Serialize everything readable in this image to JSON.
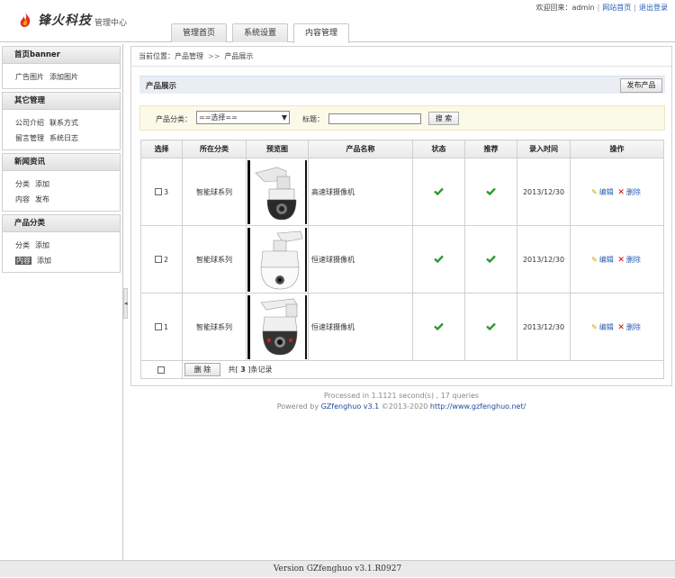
{
  "header": {
    "brand": "锋火科技",
    "brand_sub": "管理中心",
    "welcome": "欢迎回来：admin",
    "site_home": "网站首页",
    "logout": "退出登录"
  },
  "tabs": [
    {
      "label": "管理首页"
    },
    {
      "label": "系统设置"
    },
    {
      "label": "内容管理"
    }
  ],
  "sidebar": [
    {
      "title": "首页banner",
      "rows": [
        [
          "广告图片",
          "添加图片"
        ]
      ]
    },
    {
      "title": "其它管理",
      "rows": [
        [
          "公司介绍",
          "联系方式"
        ],
        [
          "留言管理",
          "系统日志"
        ]
      ]
    },
    {
      "title": "新闻资讯",
      "rows": [
        [
          "分类",
          "添加"
        ],
        [
          "内容",
          "发布"
        ]
      ]
    },
    {
      "title": "产品分类",
      "rows": [
        [
          "分类",
          "添加"
        ],
        [
          "内容",
          "添加"
        ]
      ]
    }
  ],
  "breadcrumb": {
    "prefix": "当前位置：",
    "level1": "产品管理",
    "sep": ">>",
    "level2": "产品展示"
  },
  "panel": {
    "title": "产品展示",
    "publish": "发布产品"
  },
  "search": {
    "category_label": "产品分类：",
    "category_value": "==选择==",
    "title_label": "标题：",
    "title_value": "",
    "button": "搜 索"
  },
  "table": {
    "headers": [
      "选择",
      "所在分类",
      "预览图",
      "产品名称",
      "状态",
      "推荐",
      "录入时间",
      "操作"
    ],
    "rows": [
      {
        "id": "3",
        "category": "智能球系列",
        "name": "高速球摄像机",
        "date": "2013/12/30",
        "thumb": "camera-dome-dark"
      },
      {
        "id": "2",
        "category": "智能球系列",
        "name": "恒速球摄像机",
        "date": "2013/12/30",
        "thumb": "camera-dome-white"
      },
      {
        "id": "1",
        "category": "智能球系列",
        "name": "恒速球摄像机",
        "date": "2013/12/30",
        "thumb": "camera-dome-ir"
      }
    ],
    "edit": "编辑",
    "delete": "删除",
    "bulk_delete": "删 除",
    "total_prefix": "共[",
    "total_count": "3",
    "total_suffix": "]条记录"
  },
  "stats": {
    "processed": "Processed in 1.1121 second(s) , 17 queries",
    "powered_by": "Powered by",
    "product": "GZfenghuo v3.1",
    "copyright": "©2013-2020",
    "url": "http://www.gzfenghuo.net/"
  },
  "version": "Version GZfenghuo v3.1.R0927",
  "colors": {
    "accent": "#2a5db0",
    "ok_green": "#2e9a2e",
    "delete_red": "#d40000"
  }
}
